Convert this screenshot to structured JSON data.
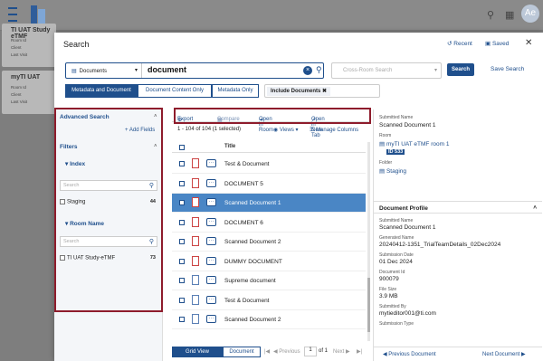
{
  "app": {
    "avatar_initials": "Ae"
  },
  "bg_cards": [
    {
      "title": "TI UAT Study eTMF",
      "line1": "Room Id",
      "line2": "Client",
      "line3": "Last Visit"
    },
    {
      "title": "myTI UAT",
      "line1": "Room Id",
      "line2": "Client",
      "line3": "Last Visit"
    }
  ],
  "modal": {
    "title": "Search",
    "recent_label": "Recent",
    "saved_label": "Saved",
    "search": {
      "scope_label": "Documents",
      "query": "document",
      "cross_room_placeholder": "Cross-Room Search",
      "search_button": "Search",
      "save_search": "Save Search"
    },
    "modes": [
      "Metadata and Document",
      "Document Content Only",
      "Metadata Only"
    ],
    "active_mode": "Metadata and Document",
    "include_chip": "Include Documents"
  },
  "left": {
    "advanced_search": "Advanced Search",
    "add_fields": "Add Fields",
    "filters": "Filters",
    "index_label": "Index",
    "search_placeholder": "Search",
    "index_items": [
      {
        "label": "Staging",
        "count": "44"
      }
    ],
    "room_name_label": "Room Name",
    "room_items": [
      {
        "label": "TI UAT Study-eTMF",
        "count": "73"
      }
    ]
  },
  "center": {
    "toolbar": {
      "export": "Export",
      "compare": "Compare",
      "open_in_room": "Open in Room",
      "open_in_new_tab": "Open in New Tab"
    },
    "count_text": "1 - 104 of 104 (1 selected)",
    "views_label": "Views",
    "manage_columns": "Manage Columns",
    "title_header": "Title",
    "rows": [
      {
        "name": "Test & Document",
        "type": "pdf",
        "selected": false
      },
      {
        "name": "DOCUMENT 5",
        "type": "pdf",
        "selected": false
      },
      {
        "name": "Scanned Document 1",
        "type": "pdf",
        "selected": true
      },
      {
        "name": "DOCUMENT 6",
        "type": "pdf",
        "selected": false
      },
      {
        "name": "Scanned Document 2",
        "type": "pdf",
        "selected": false
      },
      {
        "name": "DUMMY DOCUMENT",
        "type": "pdf",
        "selected": false
      },
      {
        "name": "Supreme document",
        "type": "doc",
        "selected": false
      },
      {
        "name": "Test & Document",
        "type": "doc",
        "selected": false
      },
      {
        "name": "Scanned Document 2",
        "type": "doc",
        "selected": false
      }
    ],
    "footer": {
      "grid_view": "Grid View",
      "document": "Document",
      "previous": "Previous",
      "page": "1",
      "of": "of 1",
      "next": "Next"
    }
  },
  "right": {
    "submitted_name_label": "Submitted Name",
    "submitted_name": "Scanned Document 1",
    "room_label": "Room",
    "room_name": "myTI UAT eTMF room 1",
    "room_id": "ID 533",
    "folder_label": "Folder",
    "folder_name": "Staging",
    "profile_header": "Document Profile",
    "fields": [
      {
        "label": "Submitted Name",
        "value": "Scanned Document 1"
      },
      {
        "label": "Generated Name",
        "value": "20240412-1351_TrialTeamDetails_02Dec2024"
      },
      {
        "label": "Submission Date",
        "value": "01 Dec 2024"
      },
      {
        "label": "Document Id",
        "value": "900079"
      },
      {
        "label": "File Size",
        "value": "3.9 MB"
      },
      {
        "label": "Submitted By",
        "value": "mytieditor001@ti.com"
      },
      {
        "label": "Submission Type",
        "value": ""
      }
    ],
    "prev_doc": "Previous Document",
    "next_doc": "Next Document"
  }
}
